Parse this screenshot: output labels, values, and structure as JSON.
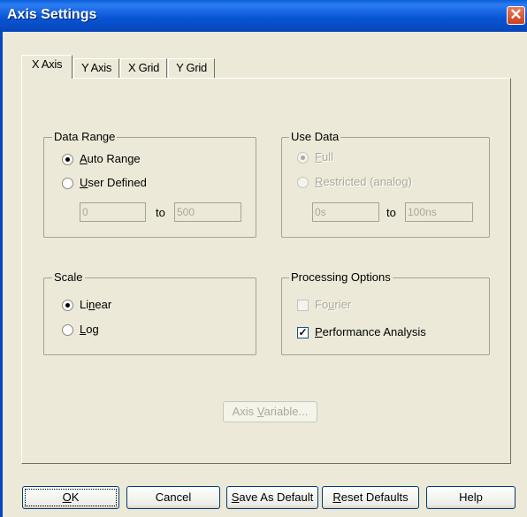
{
  "window": {
    "title": "Axis Settings",
    "close_label": "✕"
  },
  "tabs": [
    {
      "label": "X Axis",
      "active": true
    },
    {
      "label": "Y Axis",
      "active": false
    },
    {
      "label": "X Grid",
      "active": false
    },
    {
      "label": "Y Grid",
      "active": false
    }
  ],
  "data_range": {
    "title": "Data Range",
    "auto_prefix": "",
    "auto_key": "A",
    "auto_rest": "uto Range",
    "user_prefix": "",
    "user_key": "U",
    "user_rest": "ser Defined",
    "selected": "auto",
    "from_value": "0",
    "to_label": "to",
    "to_value": "500"
  },
  "use_data": {
    "title": "Use Data",
    "full_prefix": "",
    "full_key": "F",
    "full_rest": "ull",
    "restricted_prefix": "",
    "restricted_key": "R",
    "restricted_rest": "estricted (analog)",
    "selected": "full",
    "from_value": "0s",
    "to_label": "to",
    "to_value": "100ns"
  },
  "scale": {
    "title": "Scale",
    "linear_prefix": "Li",
    "linear_key": "n",
    "linear_rest": "ear",
    "log_prefix": "",
    "log_key": "L",
    "log_rest": "og",
    "selected": "linear"
  },
  "processing": {
    "title": "Processing Options",
    "fourier_prefix": "Fo",
    "fourier_key": "u",
    "fourier_rest": "rier",
    "fourier_checked": false,
    "perf_prefix": "",
    "perf_key": "P",
    "perf_rest": "erformance Analysis",
    "perf_checked": true,
    "check_glyph": "✓"
  },
  "axis_variable": {
    "prefix": "Axis ",
    "key": "V",
    "rest": "ariable..."
  },
  "buttons": {
    "ok": {
      "prefix": "",
      "key": "O",
      "rest": "K"
    },
    "cancel": {
      "label": "Cancel"
    },
    "save_default": {
      "prefix": "",
      "key": "S",
      "rest": "ave As Default"
    },
    "reset_defaults": {
      "prefix": "",
      "key": "R",
      "rest": "eset Defaults"
    },
    "help": {
      "label": "Help"
    }
  }
}
